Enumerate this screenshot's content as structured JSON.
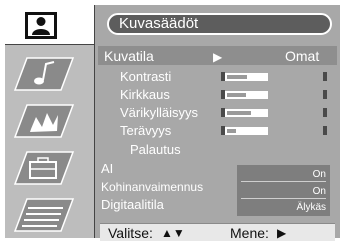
{
  "menu": {
    "title": "Kuvasäädöt",
    "selected_item": {
      "label": "Kuvatila",
      "arrow": "▶",
      "value": "Omat"
    },
    "items": [
      {
        "label": "Kontrasti",
        "level": 0.55
      },
      {
        "label": "Kirkkaus",
        "level": 0.5
      },
      {
        "label": "Värikylläisyys",
        "level": 0.65
      },
      {
        "label": "Terävyys",
        "level": 0.25
      }
    ],
    "reset_label": "Palautus",
    "options": [
      {
        "label": "AI",
        "value": "On"
      },
      {
        "label": "Kohinanvaimennus",
        "value": "On"
      },
      {
        "label": "Digitaalitila",
        "value": "Älykäs"
      }
    ]
  },
  "footer": {
    "select_label": "Valitse:",
    "select_keys": "▲▼",
    "go_label": "Mene:",
    "go_key": "▶"
  },
  "colors": {
    "panel": "#a8a8a8",
    "title_bg": "#5d5d5d",
    "sidebar": "#bdbdbd"
  },
  "icons": [
    "user-icon",
    "music-icon",
    "ambience-icon",
    "toolbox-icon",
    "document-icon"
  ]
}
